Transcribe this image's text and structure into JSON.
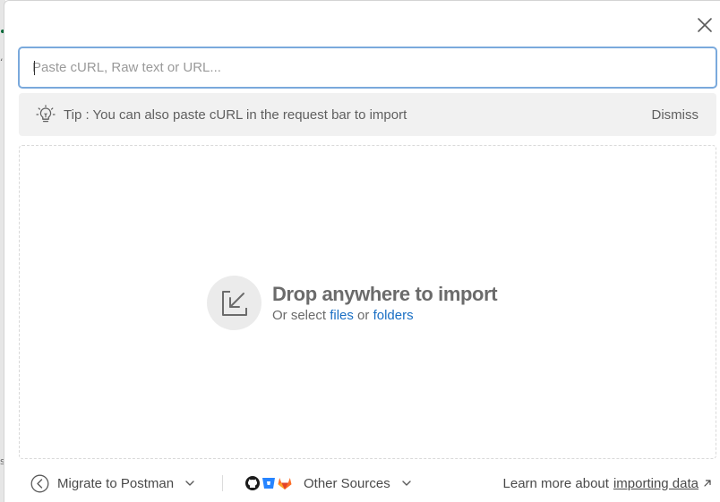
{
  "backdrop": {
    "glyphs": [
      "ʻ",
      "s"
    ]
  },
  "dialog": {
    "close_label": "Close",
    "search": {
      "placeholder": "Paste cURL, Raw text or URL...",
      "value": ""
    },
    "tip": {
      "text": "Tip : You can also paste cURL in the request bar to import",
      "dismiss_label": "Dismiss"
    },
    "dropzone": {
      "title": "Drop anywhere to import",
      "sub_prefix": "Or select",
      "files_link": "files",
      "or_text": "or",
      "folders_link": "folders"
    },
    "footer": {
      "migrate_label": "Migrate to Postman",
      "other_sources_label": "Other Sources",
      "learn_prefix": "Learn more about",
      "learn_link": "importing data"
    }
  },
  "icons": {
    "close": "close-icon",
    "bulb": "lightbulb-icon",
    "import": "import-arrow-icon",
    "migrate": "back-arrow-circle-icon",
    "github": "github-icon",
    "bitbucket": "bitbucket-icon",
    "gitlab": "gitlab-icon",
    "external": "external-link-icon"
  },
  "colors": {
    "focus_border": "#7aa9dc",
    "link": "#1a6fc4",
    "tip_bg": "#f1f1f1"
  }
}
